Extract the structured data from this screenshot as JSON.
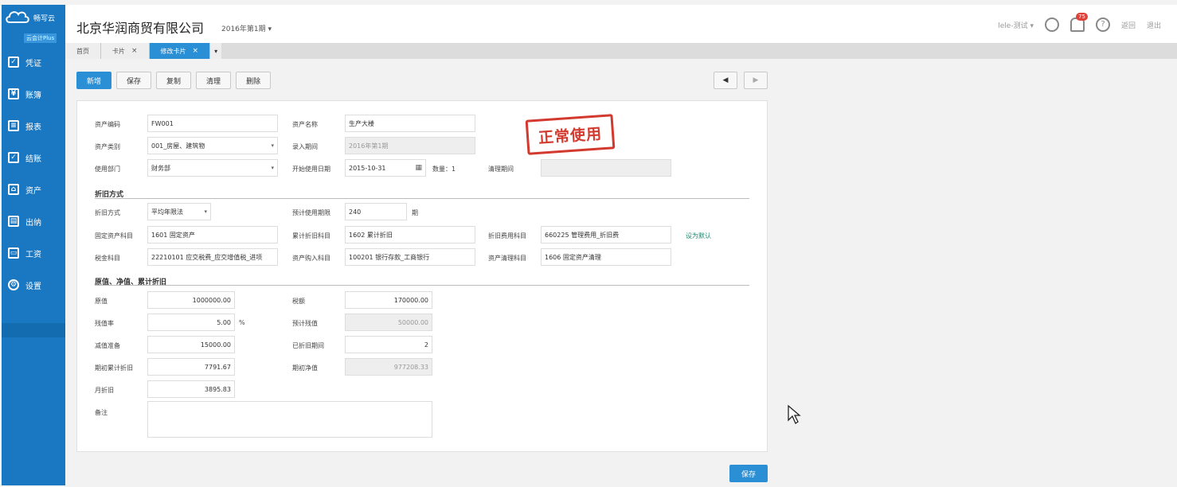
{
  "sidebar": {
    "brand": "畅写云",
    "version": "云会计Plus",
    "items": [
      {
        "label": "凭证",
        "icon": "voucher-icon",
        "glyph": "✓"
      },
      {
        "label": "账簿",
        "icon": "ledger-icon",
        "glyph": "¥"
      },
      {
        "label": "报表",
        "icon": "report-icon",
        "glyph": "≡"
      },
      {
        "label": "结账",
        "icon": "checkout-icon",
        "glyph": "✓"
      },
      {
        "label": "资产",
        "icon": "asset-icon",
        "glyph": "⌂"
      },
      {
        "label": "出纳",
        "icon": "cashier-icon",
        "glyph": "▤"
      },
      {
        "label": "工资",
        "icon": "salary-icon",
        "glyph": "▭"
      },
      {
        "label": "设置",
        "icon": "settings-gear-icon",
        "glyph": "⚙"
      }
    ]
  },
  "header": {
    "company": "北京华润商贸有限公司",
    "period": "2016年第1期 ▾",
    "user": "lele-测试 ▾",
    "notif_count": "75",
    "back": "返回",
    "logout": "退出"
  },
  "tabs": [
    {
      "label": "首页",
      "closable": false
    },
    {
      "label": "卡片",
      "closable": true
    },
    {
      "label": "修改卡片",
      "closable": true,
      "active": true
    }
  ],
  "toolbar": {
    "new": "新增",
    "save": "保存",
    "copy": "复制",
    "clear": "清理",
    "delete": "删除"
  },
  "pager": {
    "prev": "◀",
    "next": "▶"
  },
  "stamp": "正常使用",
  "form": {
    "asset_code_label": "资产编码",
    "asset_code": "FW001",
    "asset_name_label": "资产名称",
    "asset_name": "生产大楼",
    "asset_type_label": "资产类别",
    "asset_type": "001_房屋、建筑物",
    "entry_period_label": "录入期间",
    "entry_period": "2016年第1期",
    "dept_label": "使用部门",
    "dept": "财务部",
    "start_date_label": "开始使用日期",
    "start_date": "2015-10-31",
    "qty_label": "数量：1",
    "clear_period_label": "清理期间",
    "clear_period": ""
  },
  "depreciation": {
    "section": "折旧方式",
    "method_label": "折旧方式",
    "method": "平均年限法",
    "life_label": "预计使用期限",
    "life": "240",
    "life_unit": "期",
    "fixed_acct_label": "固定资产科目",
    "fixed_acct": "1601 固定资产",
    "accum_acct_label": "累计折旧科目",
    "accum_acct": "1602 累计折旧",
    "expense_acct_label": "折旧费用科目",
    "expense_acct": "660225 管理费用_折旧费",
    "set_default": "设为默认",
    "tax_acct_label": "税金科目",
    "tax_acct": "22210101 应交税费_应交增值税_进项",
    "purchase_acct_label": "资产购入科目",
    "purchase_acct": "100201 银行存款_工商银行",
    "clean_acct_label": "资产清理科目",
    "clean_acct": "1606 固定资产清理"
  },
  "values": {
    "section": "原值、净值、累计折旧",
    "orig_label": "原值",
    "orig": "1000000.00",
    "tax_label": "税额",
    "tax": "170000.00",
    "residual_rate_label": "残值率",
    "residual_rate": "5.00",
    "pct": "%",
    "est_residual_label": "预计残值",
    "est_residual": "50000.00",
    "impair_label": "减值准备",
    "impair": "15000.00",
    "depr_periods_label": "已折旧期间",
    "depr_periods": "2",
    "begin_accum_label": "期初累计折旧",
    "begin_accum": "7791.67",
    "begin_net_label": "期初净值",
    "begin_net": "977208.33",
    "monthly_label": "月折旧",
    "monthly": "3895.83",
    "remark_label": "备注",
    "remark": ""
  },
  "footer": {
    "save": "保存"
  }
}
